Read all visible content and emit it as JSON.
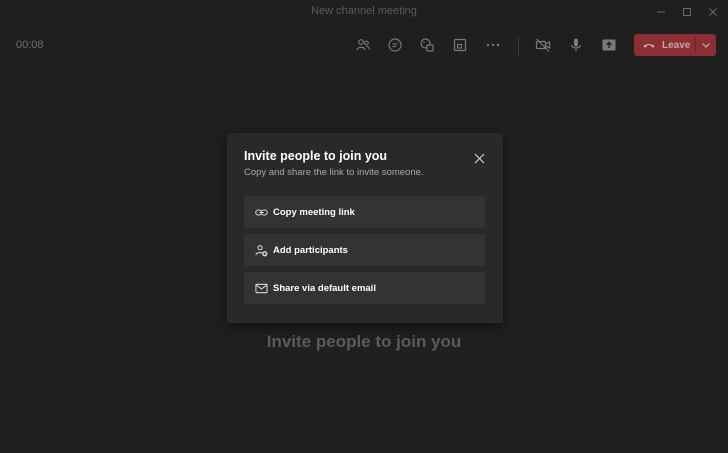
{
  "window": {
    "title": "New channel meeting",
    "controls": [
      "minimize-icon",
      "maximize-icon",
      "close-icon"
    ]
  },
  "meeting_bar": {
    "timer": "00:08",
    "controls": [
      "participants-icon",
      "chat-icon",
      "reactions-icon",
      "breakout-icon",
      "more-icon",
      "camera-off-icon",
      "microphone-icon",
      "share-screen-icon"
    ],
    "leave_label": "Leave",
    "leave_color": "#8a2f35"
  },
  "dialog": {
    "title": "Invite people to join you",
    "subtitle": "Copy and share the link to invite someone.",
    "options": [
      {
        "label": "Copy meeting link",
        "icon": "link-icon"
      },
      {
        "label": "Add participants",
        "icon": "add-person-icon"
      },
      {
        "label": "Share via default email",
        "icon": "mail-icon"
      }
    ]
  },
  "stage": {
    "heading": "Invite people to join you"
  }
}
